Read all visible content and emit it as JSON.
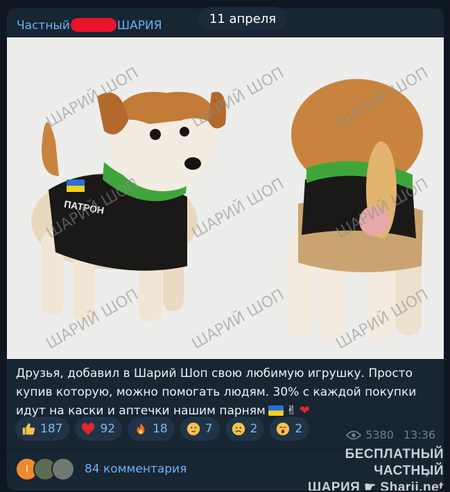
{
  "date_separator": "11 апреля",
  "channel": {
    "name_prefix": "Частный",
    "name_suffix": "ШАРИЯ"
  },
  "image": {
    "watermark_text": "ШАРИЙ ШОП",
    "vest_label": "ПАТРОН"
  },
  "message": {
    "text": "Друзья, добавил в Шарий Шоп свою любимую игрушку. Просто купив которую, можно помогать людям. 30% с каждой покупки идут на каски и аптечки нашим парням",
    "trailing_emoji": [
      "ukraine-flag",
      "victory-hand",
      "red-heart"
    ]
  },
  "reactions": [
    {
      "icon": "thumbs-up",
      "count": "187"
    },
    {
      "icon": "red-heart",
      "count": "92"
    },
    {
      "icon": "fire",
      "count": "18"
    },
    {
      "icon": "thinking-face",
      "count": "7"
    },
    {
      "icon": "crying-face",
      "count": "2"
    },
    {
      "icon": "yawning-face",
      "count": "2"
    }
  ],
  "meta": {
    "views": "5380",
    "time": "13:36"
  },
  "comments": {
    "avatar_letter": "I",
    "label": "84 комментария"
  },
  "corner_watermark": {
    "line1": "БЕСПЛАТНЫЙ ЧАСТНЫЙ",
    "line2": "ШАРИЯ",
    "line2_site": "Sharij.net"
  },
  "colors": {
    "link": "#6ab3f3",
    "bubble": "#182533",
    "reaction_bg": "#213447"
  }
}
